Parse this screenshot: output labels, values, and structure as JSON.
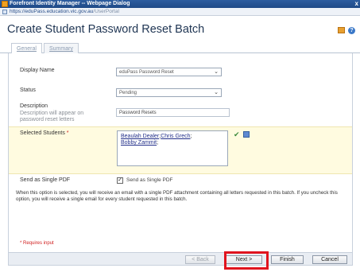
{
  "window": {
    "title": "Forefront Identity Manager -- Webpage Dialog",
    "close_glyph": "x"
  },
  "url": {
    "host": "https://eduPass.education.vic.gov.au",
    "path": "/UserPortal"
  },
  "header": {
    "title": "Create Student Password Reset Batch",
    "help_glyph": "?"
  },
  "tabs": [
    {
      "label": "General"
    },
    {
      "label": "Summary"
    }
  ],
  "form": {
    "display_name": {
      "label": "Display Name",
      "value": "eduPass Password Reset"
    },
    "status": {
      "label": "Status",
      "value": "Pending"
    },
    "description": {
      "label": "Description",
      "hint": "Description will appear on password reset letters",
      "value": "Password Resets"
    },
    "students": {
      "label": "Selected Students",
      "required_mark": "*",
      "items": [
        "Beaulah Dealer",
        "Chris Grech",
        "Bobby Zammit"
      ]
    },
    "single_pdf": {
      "label": "Send as Single PDF",
      "checkbox_label": "Send as Single PDF",
      "checked": true,
      "check_glyph": "✓"
    },
    "note": "When this option is selected, you will receive an email with a single PDF attachment containing all letters requested in this batch. If you uncheck this option, you will receive a single email for every student requested in this batch.",
    "required_note": "* Requires input"
  },
  "buttons": {
    "back": "< Back",
    "next": "Next >",
    "finish": "Finish",
    "cancel": "Cancel"
  },
  "colors": {
    "accent": "#2d5d9f",
    "highlight": "#e0141e",
    "students_bg": "#fffbe0"
  }
}
